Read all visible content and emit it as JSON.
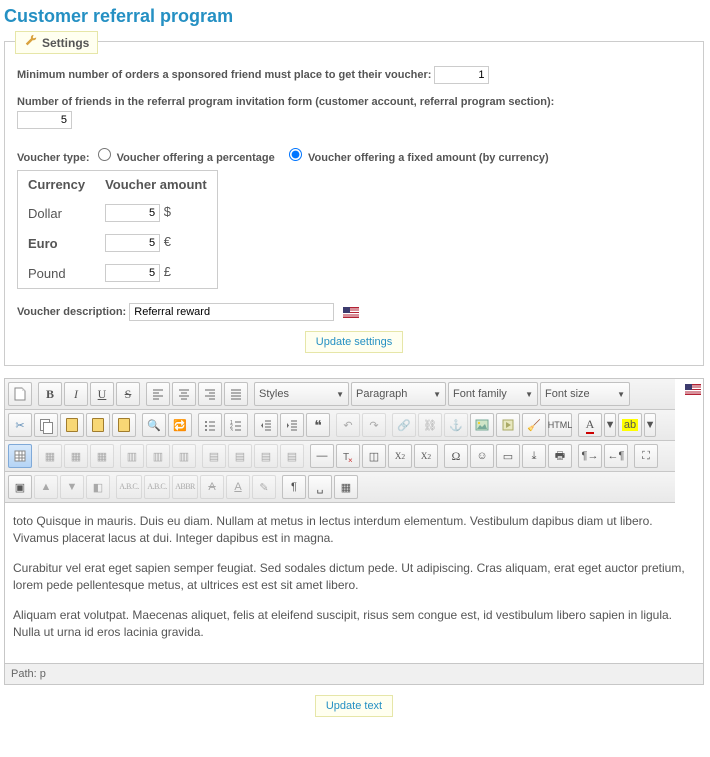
{
  "title": "Customer referral program",
  "legend": "Settings",
  "settings": {
    "min_orders_label": "Minimum number of orders a sponsored friend must place to get their voucher:",
    "min_orders": "1",
    "friends_label": "Number of friends in the referral program invitation form (customer account, referral program section):",
    "friends": "5",
    "voucher_type_label": "Voucher type:",
    "opt_percent": "Voucher offering a percentage",
    "opt_fixed": "Voucher offering a fixed amount (by currency)",
    "table": {
      "h1": "Currency",
      "h2": "Voucher amount",
      "rows": [
        {
          "name": "Dollar",
          "val": "5",
          "sym": "$",
          "bold": false
        },
        {
          "name": "Euro",
          "val": "5",
          "sym": "€",
          "bold": true
        },
        {
          "name": "Pound",
          "val": "5",
          "sym": "£",
          "bold": false
        }
      ]
    },
    "desc_label": "Voucher description:",
    "desc_value": "Referral reward",
    "update_btn": "Update settings"
  },
  "toolbar": {
    "styles": "Styles",
    "para": "Paragraph",
    "ff": "Font family",
    "fs": "Font size"
  },
  "editor": {
    "p1": "toto Quisque in mauris. Duis eu diam. Nullam at metus in lectus interdum elementum. Vestibulum dapibus diam ut libero. Vivamus placerat lacus at dui. Integer dapibus est in magna.",
    "p2": "Curabitur vel erat eget sapien semper feugiat. Sed sodales dictum pede. Ut adipiscing. Cras aliquam, erat eget auctor pretium, lorem pede pellentesque metus, at ultrices est est sit amet libero.",
    "p3": "Aliquam erat volutpat. Maecenas aliquet, felis at eleifend suscipit, risus sem congue est, id vestibulum libero sapien in ligula. Nulla ut urna id eros lacinia gravida.",
    "path": "Path: p"
  },
  "update_text": "Update text"
}
